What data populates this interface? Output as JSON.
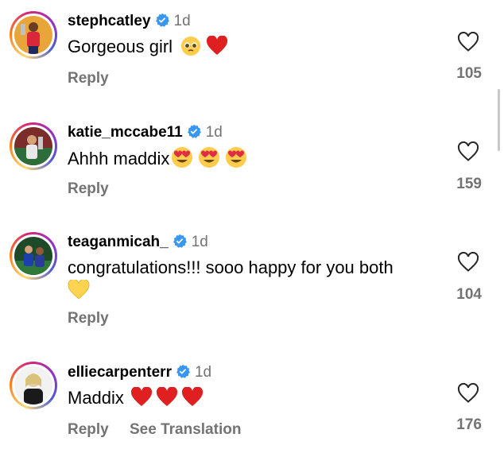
{
  "comments": [
    {
      "username": "stephcatley",
      "time": "1d",
      "text": "Gorgeous girl",
      "emojis": [
        "pleading-face",
        "red-heart"
      ],
      "reply": "Reply",
      "likes": "105"
    },
    {
      "username": "katie_mccabe11",
      "time": "1d",
      "text": "Ahhh maddix",
      "emojis": [
        "heart-eyes",
        "heart-eyes",
        "heart-eyes"
      ],
      "reply": "Reply",
      "likes": "159"
    },
    {
      "username": "teaganmicah_",
      "time": "1d",
      "text": "congratulations!!! sooo happy for you both",
      "emojis": [
        "yellow-heart"
      ],
      "reply": "Reply",
      "likes": "104"
    },
    {
      "username": "elliecarpenterr",
      "time": "1d",
      "text": "Maddix",
      "emojis": [
        "red-heart",
        "red-heart",
        "red-heart"
      ],
      "reply": "Reply",
      "see_translation": "See Translation",
      "likes": "176"
    }
  ],
  "colors": {
    "verified": "#3897f0",
    "secondary_text": "#737373",
    "heart_red": "#e02020",
    "heart_yellow": "#fcd44f"
  }
}
